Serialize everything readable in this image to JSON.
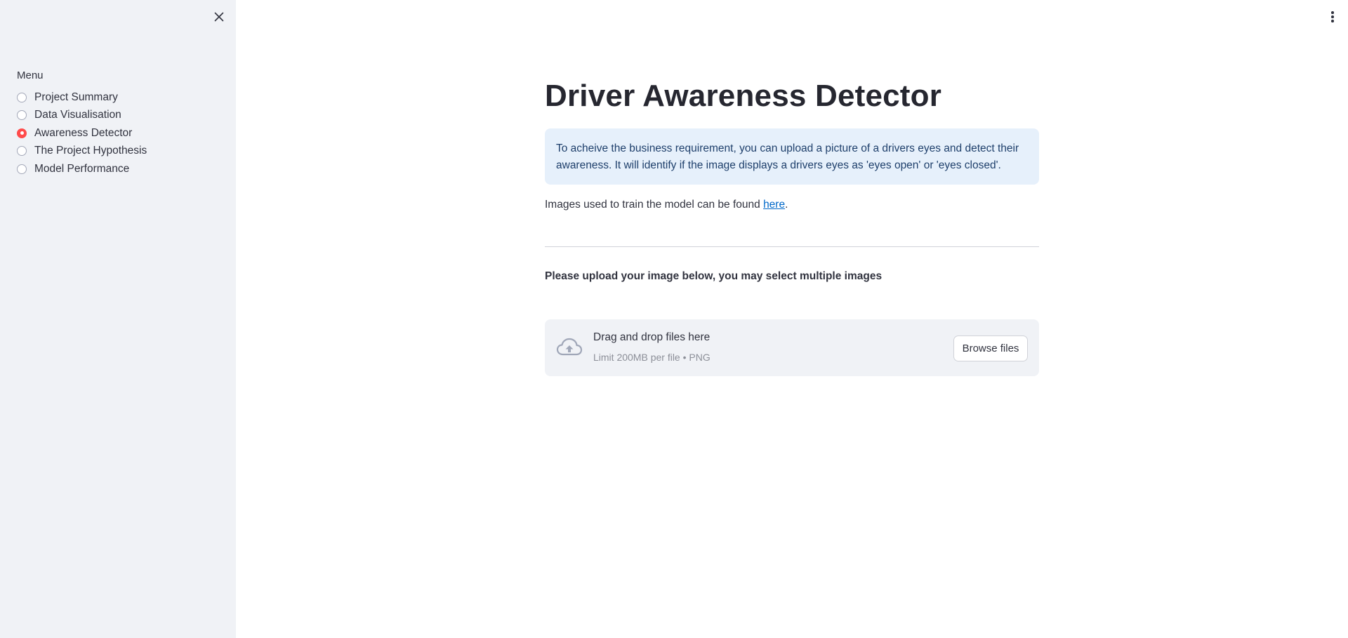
{
  "sidebar": {
    "close_icon": "close-icon",
    "menu_label": "Menu",
    "items": [
      {
        "label": "Project Summary",
        "selected": false
      },
      {
        "label": "Data Visualisation",
        "selected": false
      },
      {
        "label": "Awareness Detector",
        "selected": true
      },
      {
        "label": "The Project Hypothesis",
        "selected": false
      },
      {
        "label": "Model Performance",
        "selected": false
      }
    ]
  },
  "main": {
    "menu_icon": "kebab-menu-icon",
    "title": "Driver Awareness Detector",
    "info_text": "To acheive the business requirement, you can upload a picture of a drivers eyes and detect their awareness. It will identify if the image displays a drivers eyes as 'eyes open' or 'eyes closed'.",
    "train_text_prefix": "Images used to train the model can be found ",
    "train_link_text": "here",
    "train_text_suffix": ".",
    "upload_heading": "Please upload your image below, you may select multiple images",
    "uploader": {
      "icon": "cloud-upload-icon",
      "title": "Drag and drop files here",
      "limit": "Limit 200MB per file • PNG",
      "browse_label": "Browse files"
    }
  },
  "colors": {
    "accent": "#ff4b4b",
    "sidebar_bg": "#f0f2f6",
    "info_bg": "#e6f0fb",
    "info_text": "#1e3f6b",
    "link": "#0068c9",
    "text": "#31333f"
  }
}
